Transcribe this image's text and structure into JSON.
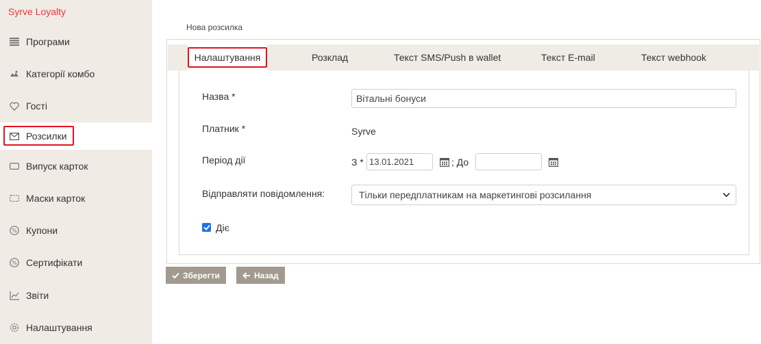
{
  "app": {
    "brand": "Syrve Loyalty"
  },
  "sidebar": {
    "items": [
      {
        "label": "Програми",
        "icon": "list-icon"
      },
      {
        "label": "Категорії комбо",
        "icon": "combo-icon"
      },
      {
        "label": "Гості",
        "icon": "heart-icon"
      },
      {
        "label": "Розсилки",
        "icon": "envelope-icon",
        "active": true
      },
      {
        "label": "Випуск карток",
        "icon": "card-icon"
      },
      {
        "label": "Маски карток",
        "icon": "card-mask-icon"
      },
      {
        "label": "Купони",
        "icon": "percent-icon"
      },
      {
        "label": "Сертифікати",
        "icon": "percent-icon"
      },
      {
        "label": "Звіти",
        "icon": "chart-icon"
      },
      {
        "label": "Налаштування",
        "icon": "gear-icon"
      }
    ]
  },
  "main": {
    "breadcrumb": "Нова розсилка",
    "tabs": [
      {
        "label": "Налаштування",
        "active": true
      },
      {
        "label": "Розклад"
      },
      {
        "label": "Текст SMS/Push в wallet"
      },
      {
        "label": "Текст E-mail"
      },
      {
        "label": "Текст webhook"
      }
    ],
    "form": {
      "name_label": "Назва *",
      "name_value": "Вітальні бонуси",
      "payer_label": "Платник *",
      "payer_value": "Syrve",
      "period_label": "Період дії",
      "from_label": "З *",
      "from_value": "13.01.2021",
      "to_label": "; До",
      "to_value": "",
      "send_label": "Відправляти повідомлення:",
      "send_value": "Тільки передплатникам на маркетингові розсилання",
      "active_label": "Діє",
      "active_checked": true
    },
    "buttons": {
      "save": "Зберегти",
      "back": "Назад"
    }
  },
  "colors": {
    "brand": "#e5393f",
    "highlight": "#e0121c",
    "button": "#a39a8f",
    "sidebar_bg": "#f0ebe4",
    "checkbox": "#1b73e8"
  }
}
